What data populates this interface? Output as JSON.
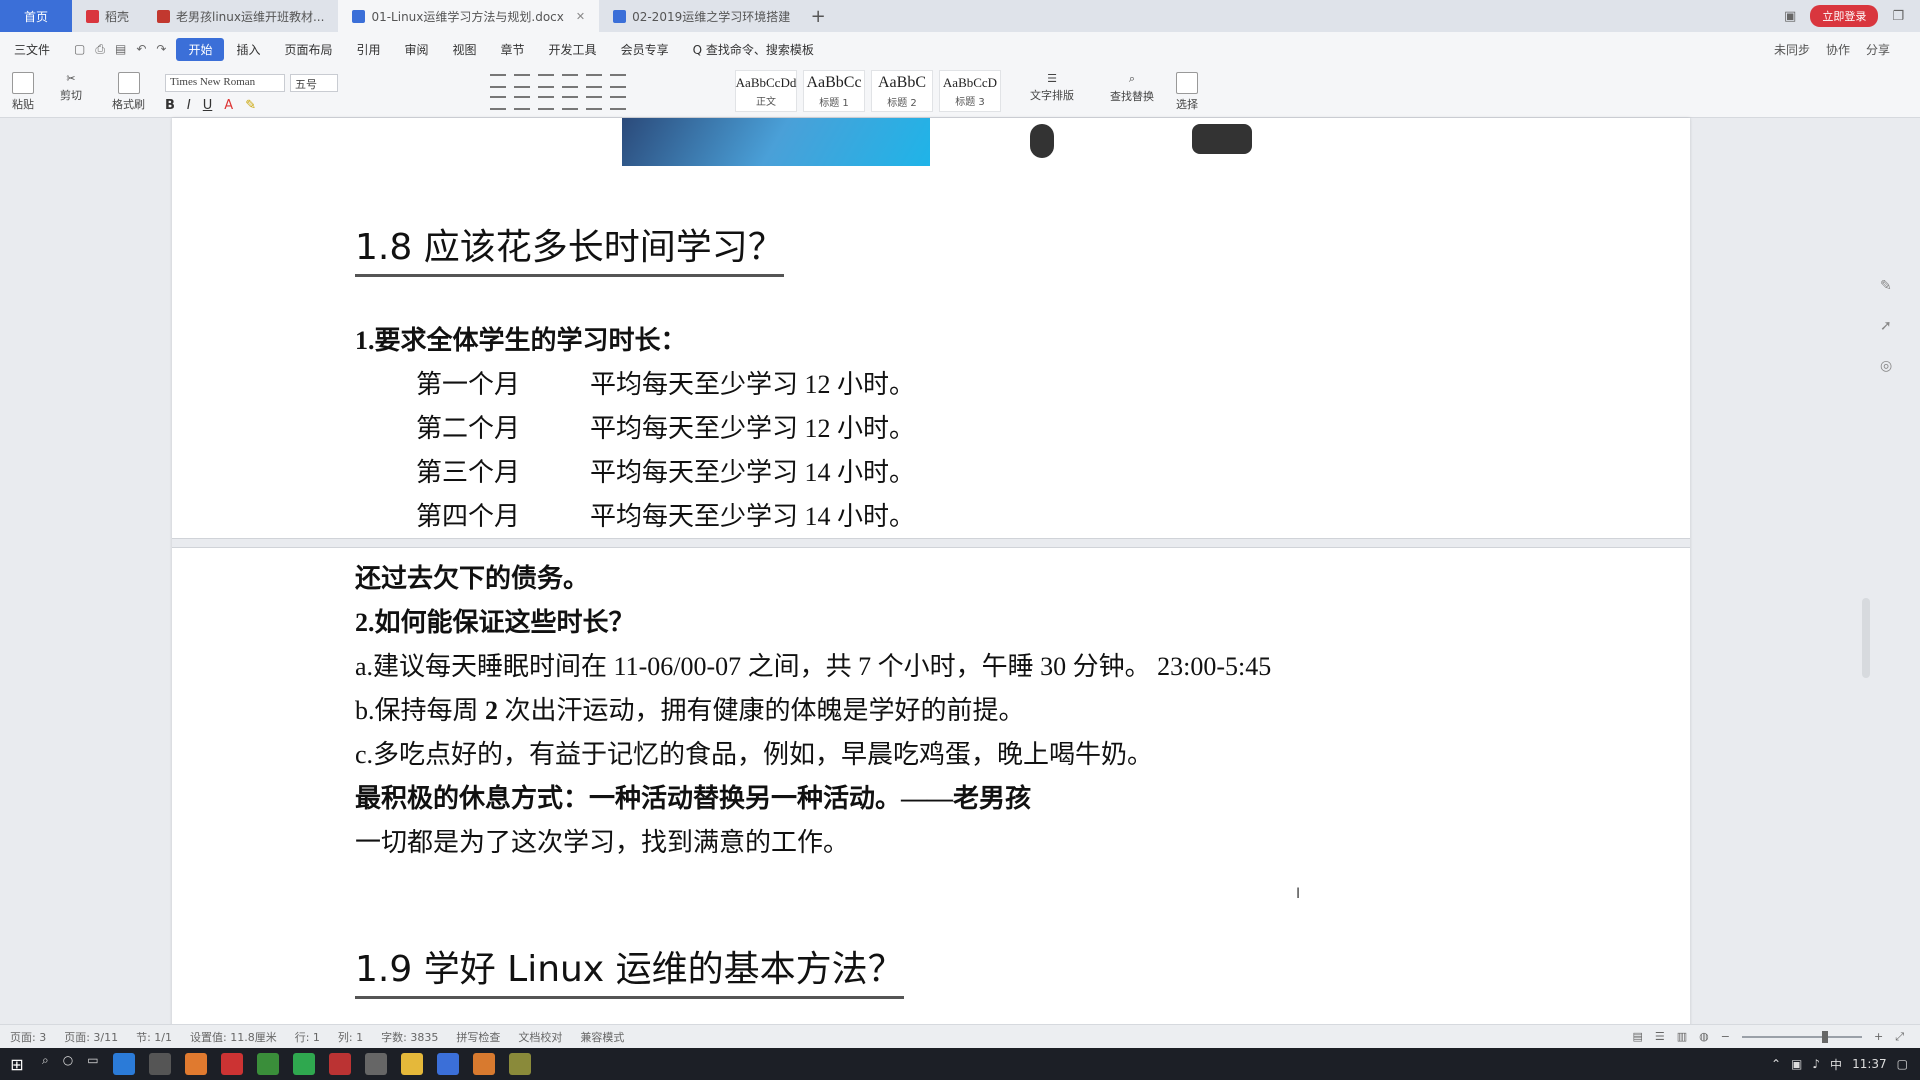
{
  "tabs": [
    {
      "label": "首页"
    },
    {
      "label": "稻壳"
    },
    {
      "label": "老男孩linux运维开班教材..."
    },
    {
      "label": "01-Linux运维学习方法与规划.docx"
    },
    {
      "label": "02-2019运维之学习环境搭建"
    }
  ],
  "tabbar": {
    "plus": "+",
    "login": "立即登录"
  },
  "menu": {
    "file": "三文件",
    "items": [
      "开始",
      "插入",
      "页面布局",
      "引用",
      "审阅",
      "视图",
      "章节",
      "开发工具",
      "会员专享",
      "Q 查找命令、搜索模板"
    ],
    "active_index": 0,
    "right": [
      "未同步",
      "协作",
      "分享"
    ]
  },
  "ribbon": {
    "paste": "粘贴",
    "cut": "剪切",
    "format_painter": "格式刷",
    "font_name": "Times New Roman",
    "font_size": "五号",
    "bold": "B",
    "italic": "I",
    "underline": "U",
    "styles": [
      {
        "sample": "AaBbCcDd",
        "label": "正文"
      },
      {
        "sample": "AaBbCc",
        "label": "标题 1"
      },
      {
        "sample": "AaBbC",
        "label": "标题 2"
      },
      {
        "sample": "AaBbCcD",
        "label": "标题 3"
      }
    ],
    "text_layout": "文字排版",
    "find_replace": "查找替换",
    "select": "选择"
  },
  "document": {
    "heading_1": "1.8  应该花多长时间学习？",
    "section1_title": "1.要求全体学生的学习时长：",
    "schedule": [
      {
        "month": "第一个月",
        "desc": "平均每天至少学习 12 小时。"
      },
      {
        "month": "第二个月",
        "desc": "平均每天至少学习 12 小时。"
      },
      {
        "month": "第三个月",
        "desc": "平均每天至少学习 14 小时。"
      },
      {
        "month": "第四个月",
        "desc": "平均每天至少学习 14 小时。"
      }
    ],
    "debt_line": "还过去欠下的债务。",
    "section2_title": "2.如何能保证这些时长？",
    "item_a": "a.建议每天睡眠时间在 11-06/00-07 之间，共 7 个小时，午睡 30 分钟。  23:00-5:45",
    "item_b_pre": "b.保持每周 ",
    "item_b_bold": "2",
    "item_b_post": " 次出汗运动，拥有健康的体魄是学好的前提。",
    "item_c": "c.多吃点好的，有益于记忆的食品，例如，早晨吃鸡蛋，晚上喝牛奶。",
    "rest_line": "最积极的休息方式：一种活动替换另一种活动。——老男孩",
    "goal_line": "一切都是为了这次学习，找到满意的工作。",
    "heading_2": "1.9  学好 Linux 运维的基本方法？"
  },
  "statusbar": {
    "items": [
      "页面: 3",
      "页面: 3/11",
      "节: 1/1",
      "设置值: 11.8厘米",
      "行: 1",
      "列: 1",
      "字数: 3835",
      "拼写检查",
      "文档校对",
      "兼容模式"
    ]
  },
  "taskbar": {
    "time": "11:37",
    "ime": "中"
  },
  "colors": {
    "accent": "#3b6fd8",
    "login": "#d9363e",
    "taskbar": "#1c1f26"
  }
}
